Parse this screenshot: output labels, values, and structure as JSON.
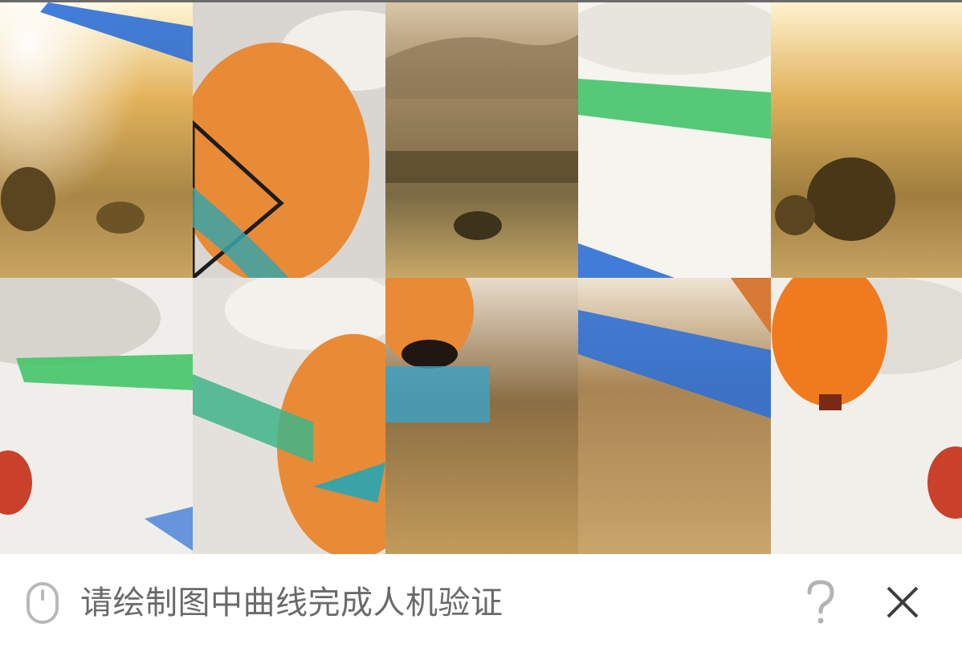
{
  "captcha": {
    "instruction": "请绘制图中曲线完成人机验证",
    "icons": {
      "mouse": "mouse-icon",
      "help": "question-mark-icon",
      "close": "close-icon"
    },
    "tiles": [
      {
        "row": 1,
        "col": 1,
        "content": "sunset-field-with-tree-and-blue-stroke"
      },
      {
        "row": 1,
        "col": 2,
        "content": "orange-balloon-closeup"
      },
      {
        "row": 1,
        "col": 3,
        "content": "hazy-hills-and-trees"
      },
      {
        "row": 1,
        "col": 4,
        "content": "bright-sky-with-green-stroke"
      },
      {
        "row": 1,
        "col": 5,
        "content": "sunset-field-with-tree"
      },
      {
        "row": 2,
        "col": 1,
        "content": "sky-with-green-stroke-and-red-balloon"
      },
      {
        "row": 2,
        "col": 2,
        "content": "orange-balloon-with-green-stroke"
      },
      {
        "row": 2,
        "col": 3,
        "content": "balloon-basket-with-teal-stroke"
      },
      {
        "row": 2,
        "col": 4,
        "content": "hills-field-with-blue-stroke"
      },
      {
        "row": 2,
        "col": 5,
        "content": "sky-with-orange-striped-balloon"
      }
    ],
    "colors": {
      "instruction_text": "#6a6a6a",
      "blue_stroke": "#2d6fd6",
      "green_stroke": "#45c46a",
      "teal_stroke": "#3aa3a8",
      "balloon_orange": "#e88a3a"
    }
  }
}
